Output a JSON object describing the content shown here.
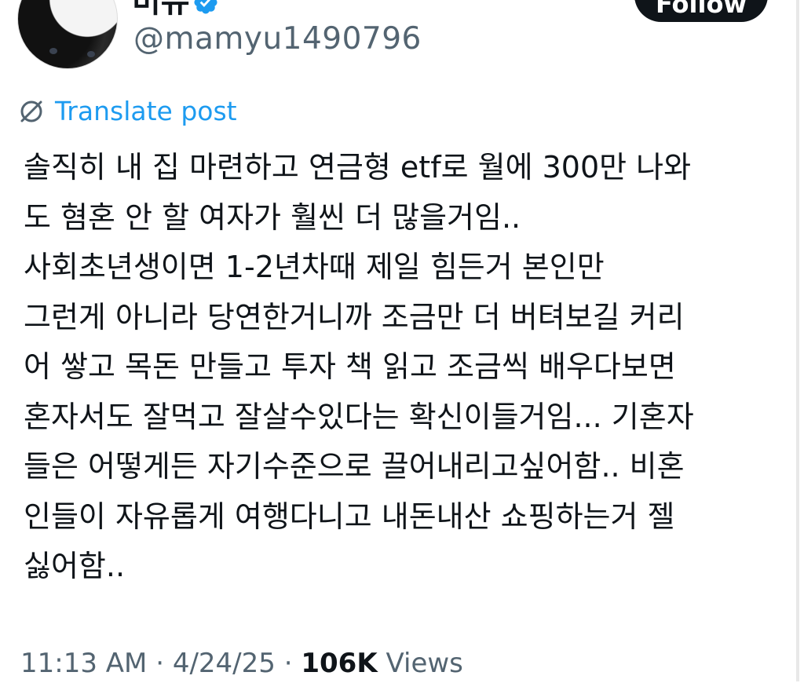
{
  "header": {
    "display_name": "미유",
    "handle": "@mamyu1490796",
    "follow_label": "Follow"
  },
  "translate": {
    "label": "Translate post"
  },
  "post": {
    "lines": [
      "솔직히 내 집 마련하고 연금형 etf로 월에 300만 나와",
      "도 혐혼 안 할 여자가 훨씬 더 많을거임..",
      "사회초년생이면  1-2년차때 제일 힘든거 본인만",
      "그런게 아니라 당연한거니까 조금만 더 버텨보길 커리",
      "어 쌓고 목돈 만들고 투자 책 읽고 조금씩 배우다보면",
      "혼자서도 잘먹고 잘살수있다는 확신이들거임... 기혼자",
      "들은 어떻게든 자기수준으로 끌어내리고싶어함.. 비혼",
      "인들이 자유롭게 여행다니고 내돈내산 쇼핑하는거 젤",
      "싫어함.."
    ]
  },
  "meta": {
    "time": "11:13 AM",
    "sep1": " · ",
    "date": "4/24/25",
    "sep2": " · ",
    "views_count": "106K",
    "views_label": " Views"
  },
  "colors": {
    "link": "#1d9bf0",
    "muted": "#536471",
    "text": "#0f1419"
  },
  "icons": {
    "verified": "verified-badge-icon",
    "translate": "translate-icon"
  }
}
